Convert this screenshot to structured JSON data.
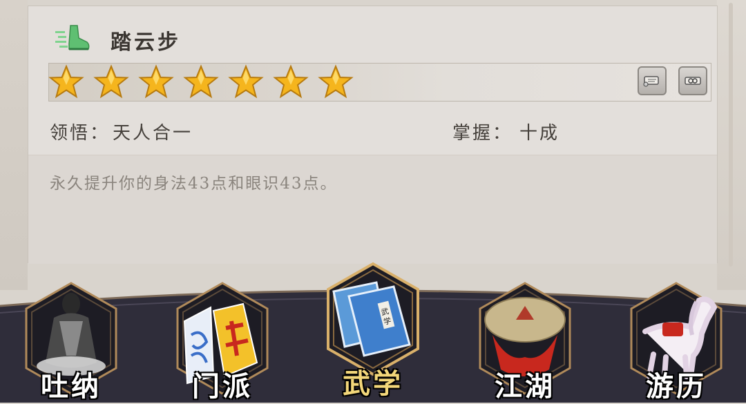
{
  "skill": {
    "name": "踏云步",
    "stars": 7,
    "comprehension_label": "领悟：",
    "comprehension_value": "天人合一",
    "mastery_label": "掌握：",
    "mastery_value": "十成",
    "description": "永久提升你的身法43点和眼识43点。"
  },
  "nav": {
    "items": [
      {
        "id": "tuna",
        "label": "吐纳",
        "icon": "meditating-monk-icon"
      },
      {
        "id": "menpai",
        "label": "门派",
        "icon": "sect-banner-icon"
      },
      {
        "id": "wuxue",
        "label": "武学",
        "icon": "martial-books-icon",
        "active": true
      },
      {
        "id": "jianghu",
        "label": "江湖",
        "icon": "straw-hat-icon"
      },
      {
        "id": "youli",
        "label": "游历",
        "icon": "horse-icon"
      }
    ]
  },
  "colors": {
    "star": "#f5b51d",
    "nav_bg": "#2f2d3a",
    "active_label": "#f3d77a",
    "hex_border": "#b08a5a"
  }
}
